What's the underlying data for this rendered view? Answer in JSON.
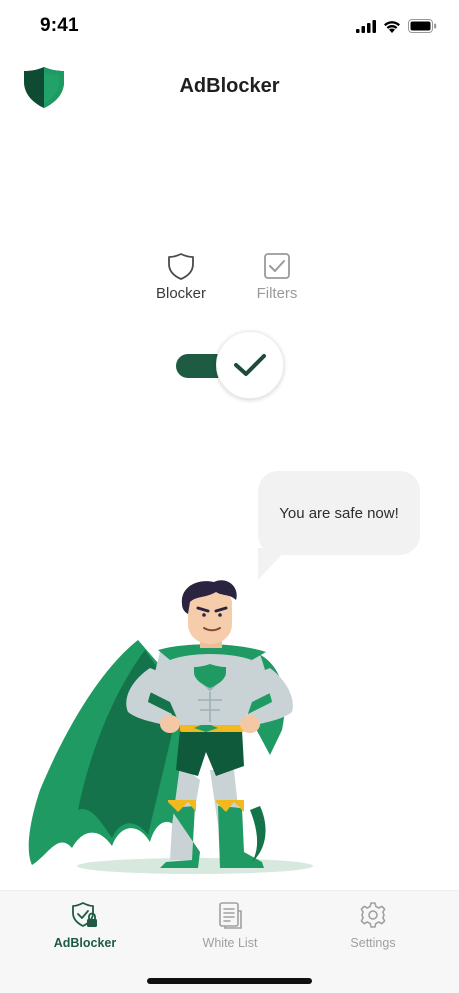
{
  "status_bar": {
    "time": "9:41",
    "icons": [
      "cellular-signal-icon",
      "wifi-icon",
      "battery-icon"
    ]
  },
  "header": {
    "title": "AdBlocker",
    "logo_icon": "shield-logo-icon"
  },
  "modes": [
    {
      "label": "Blocker",
      "icon": "shield-outline-icon",
      "active": true
    },
    {
      "label": "Filters",
      "icon": "checkbox-icon",
      "active": false
    }
  ],
  "toggle": {
    "state": "on",
    "icon": "checkmark-icon"
  },
  "speech": {
    "text": "You are safe now!"
  },
  "tabs": [
    {
      "label": "AdBlocker",
      "icon": "shield-lock-icon",
      "active": true
    },
    {
      "label": "White List",
      "icon": "document-list-icon",
      "active": false
    },
    {
      "label": "Settings",
      "icon": "gear-icon",
      "active": false
    }
  ],
  "colors": {
    "accent": "#1d5b42",
    "hero_green": "#1f9a63",
    "inactive": "#a0a0a0",
    "bubble": "#f2f2f2"
  }
}
